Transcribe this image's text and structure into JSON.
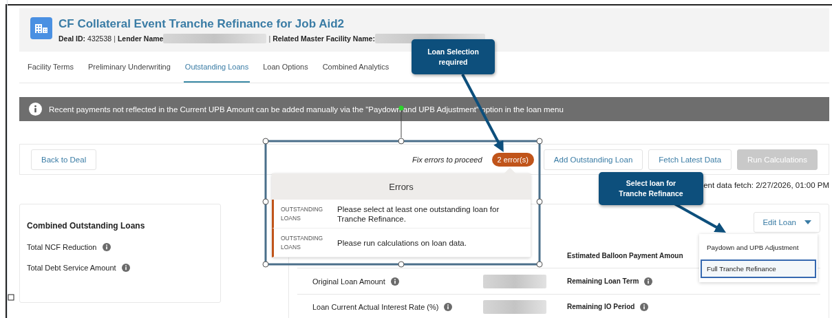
{
  "header": {
    "title": "CF Collateral Event Tranche Refinance for Job Aid2",
    "separator": "|",
    "meta": [
      {
        "label": "Deal ID:",
        "value": "432538",
        "redacted": false
      },
      {
        "label": "Lender Name",
        "redacted": true
      },
      {
        "label": "Related Master Facility Name:",
        "redacted": true
      }
    ]
  },
  "tabs": [
    {
      "label": "Facility Terms",
      "selected": false
    },
    {
      "label": "Preliminary Underwriting",
      "selected": false
    },
    {
      "label": "Outstanding Loans",
      "selected": true
    },
    {
      "label": "Loan Options",
      "selected": false
    },
    {
      "label": "Combined Analytics",
      "selected": false
    }
  ],
  "banner": {
    "text": "Recent payments not reflected in the Current UPB Amount can be added manually via the \"Paydown and UPB Adjustment\" option in the loan menu"
  },
  "actions": {
    "back": "Back to Deal",
    "fix_text": "Fix errors to proceed",
    "error_count": "2 error(s)",
    "buttons": [
      {
        "label": "Add Outstanding Loan",
        "disabled": false
      },
      {
        "label": "Fetch Latest Data",
        "disabled": false
      },
      {
        "label": "Run Calculations",
        "disabled": true
      }
    ],
    "fetch_note": "ent data fetch: 2/27/2026, 01:00 PM"
  },
  "errors": {
    "title": "Errors",
    "items": [
      {
        "source": "OUTSTANDING LOANS",
        "message": "Please select at least one outstanding loan for Tranche Refinance."
      },
      {
        "source": "OUTSTANDING LOANS",
        "message": "Please run calculations on loan data."
      }
    ]
  },
  "summary_card": {
    "title": "Combined Outstanding Loans",
    "fields": [
      "Total NCF Reduction",
      "Total Debt Service Amount"
    ]
  },
  "loan_card": {
    "edit_button": "Edit Loan",
    "rows": [
      {
        "right_label": "Estimated Balloon Payment Amoun",
        "right_info": false
      },
      {
        "left_label": "Original Loan Amount",
        "value_redacted": true,
        "right_label": "Remaining Loan Term",
        "right_info": true
      },
      {
        "left_label": "Loan Current Actual Interest Rate (%)",
        "value_redacted": true,
        "right_label": "Remaining IO Period",
        "right_info": true
      }
    ]
  },
  "menu": {
    "items": [
      {
        "label": "Paydown and UPB Adjustment",
        "selected": false
      },
      {
        "label": "Full Tranche Refinance",
        "selected": true
      }
    ]
  },
  "callouts": [
    {
      "text": "Loan Selection required"
    },
    {
      "text": "Select loan for Tranche Refinance"
    }
  ]
}
